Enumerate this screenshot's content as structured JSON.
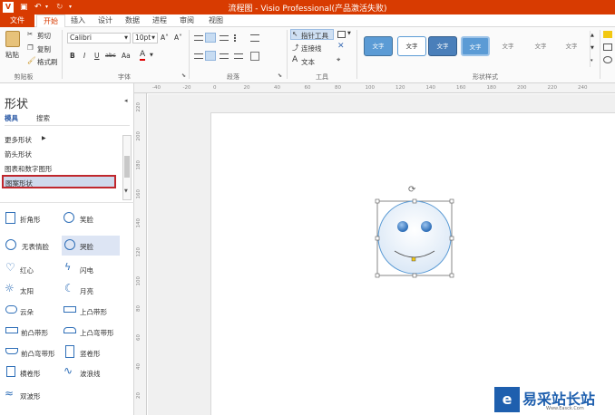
{
  "window": {
    "title": "流程图 - Visio Professional(产品激活失败)"
  },
  "tabs": [
    {
      "label": "文件"
    },
    {
      "label": "开始"
    },
    {
      "label": "插入"
    },
    {
      "label": "设计"
    },
    {
      "label": "数据"
    },
    {
      "label": "进程"
    },
    {
      "label": "审阅"
    },
    {
      "label": "视图"
    }
  ],
  "ribbon": {
    "clipboard": {
      "paste": "粘贴",
      "cut": "剪切",
      "copy": "复制",
      "format_painter": "格式刷",
      "label": "剪贴板"
    },
    "font": {
      "family": "Calibri",
      "size": "10pt",
      "bold": "B",
      "italic": "I",
      "underline": "U",
      "strike": "abc",
      "case": "Aa",
      "color": "A",
      "label": "字体"
    },
    "paragraph": {
      "label": "段落"
    },
    "tools": {
      "pointer": "指针工具",
      "connector": "连接线",
      "text": "文本",
      "label": "工具"
    },
    "shape_styles": {
      "sample": "文字",
      "label": "形状样式"
    }
  },
  "sidebar": {
    "title": "形状",
    "tab_stencils": "模具",
    "tab_search": "搜索",
    "more_shapes": "更多形状",
    "stencil_list": [
      "箭头形状",
      "图表和数字图形",
      "图案形状"
    ],
    "shapes": [
      {
        "label": "折角形"
      },
      {
        "label": "笑脸"
      },
      {
        "label": "无表情脸"
      },
      {
        "label": "哭脸"
      },
      {
        "label": "红心"
      },
      {
        "label": "闪电"
      },
      {
        "label": "太阳"
      },
      {
        "label": "月亮"
      },
      {
        "label": "云朵"
      },
      {
        "label": "上凸带形"
      },
      {
        "label": "前凸带形"
      },
      {
        "label": "上凸弯带形"
      },
      {
        "label": "前凸弯带形"
      },
      {
        "label": "竖卷形"
      },
      {
        "label": "横卷形"
      },
      {
        "label": "波浪线"
      },
      {
        "label": "双波形"
      }
    ]
  },
  "ruler": {
    "h_ticks": [
      "-40",
      "-20",
      "0",
      "20",
      "40",
      "60",
      "80",
      "100",
      "120",
      "140",
      "160",
      "180",
      "200",
      "220",
      "240"
    ],
    "v_ticks": [
      "220",
      "200",
      "180",
      "160",
      "140",
      "120",
      "100",
      "80",
      "60",
      "40",
      "20"
    ]
  },
  "watermark": {
    "text": "易采站长站",
    "sub": "Www.Easck.Com"
  },
  "colors": {
    "accent": "#d83b01",
    "selected_stencil_border": "#c0272d",
    "smiley_eye": "#2f6fb8"
  }
}
